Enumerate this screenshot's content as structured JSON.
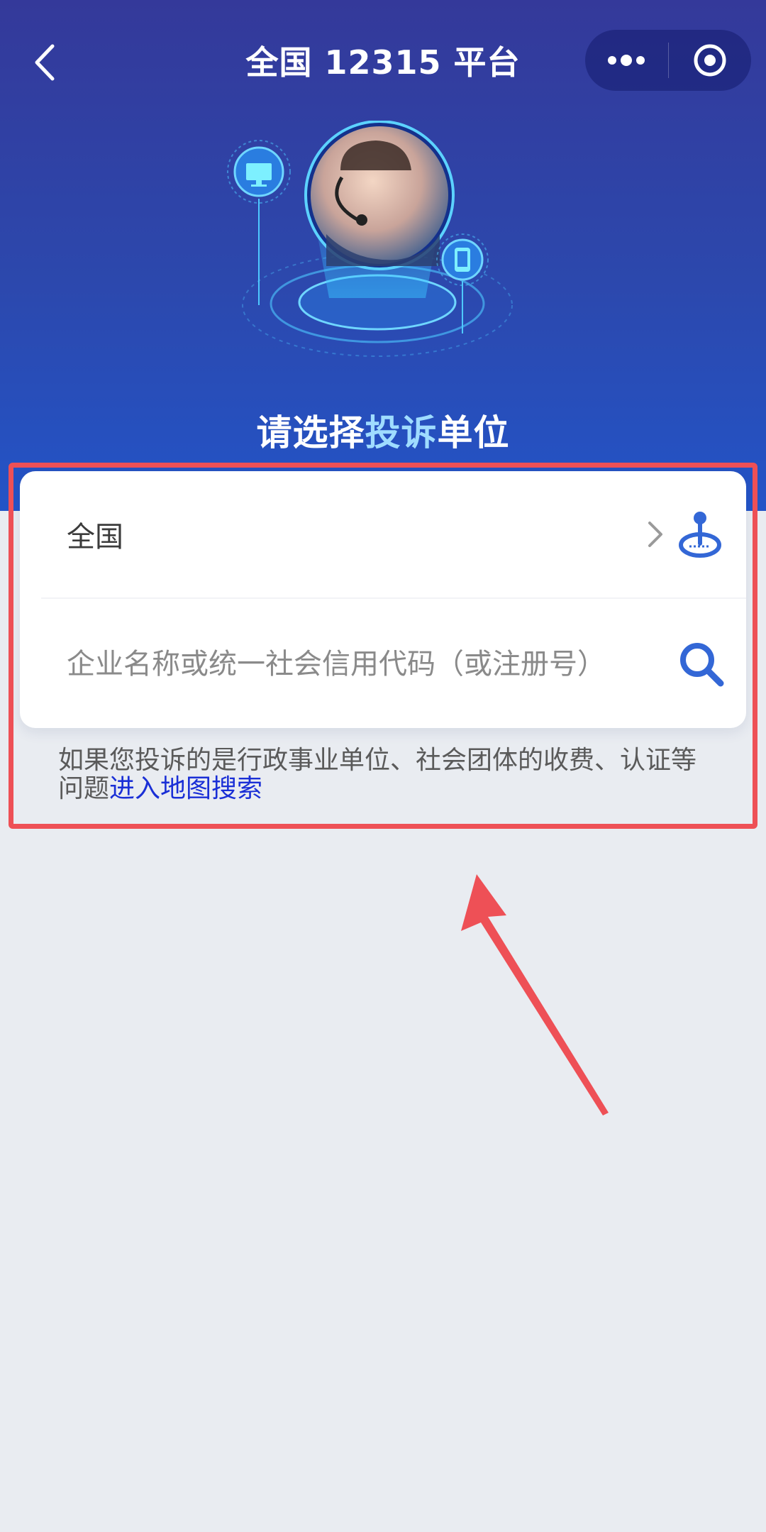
{
  "header": {
    "title": "全国 12315 平台",
    "back_icon": "chevron-left-icon",
    "capsule": {
      "more_icon": "more-dots-icon",
      "close_icon": "target-circle-icon"
    }
  },
  "hero": {
    "headline_part1": "请选择",
    "headline_highlight": "投诉",
    "headline_part2": "单位"
  },
  "card": {
    "region_label": "全国",
    "region_icons": [
      "chevron-right-icon",
      "location-pin-icon"
    ],
    "search_placeholder": "企业名称或统一社会信用代码（或注册号）",
    "search_value": "",
    "search_icon": "search-icon"
  },
  "note": {
    "text": "如果您投诉的是行政事业单位、社会团体的收费、认证等问题",
    "link": "进入地图搜索"
  },
  "colors": {
    "header_top": "#34399a",
    "header_bottom": "#2354c7",
    "accent_blue": "#3367d6",
    "link_blue": "#1a2fd6",
    "annotation_red": "#ee5056",
    "background": "#e9ecf1"
  }
}
